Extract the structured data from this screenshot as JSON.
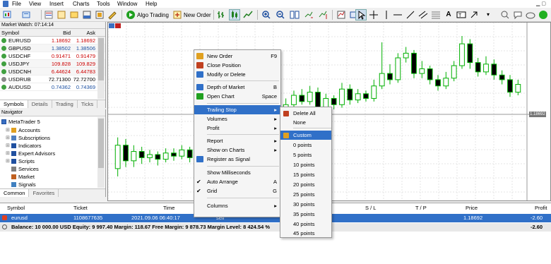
{
  "menu": [
    "File",
    "View",
    "Insert",
    "Charts",
    "Tools",
    "Window",
    "Help"
  ],
  "toolbar": {
    "algo_trading": "Algo Trading",
    "new_order": "New Order"
  },
  "market_watch": {
    "title": "Market Watch: 07:14:14",
    "headers": {
      "symbol": "Symbol",
      "bid": "Bid",
      "ask": "Ask"
    },
    "rows": [
      {
        "symbol": "EURUSD",
        "bid": "1.18692",
        "ask": "1.18692",
        "color": "#cc0000"
      },
      {
        "symbol": "GBPUSD",
        "bid": "1.38502",
        "ask": "1.38506",
        "color": "#1a4fa0"
      },
      {
        "symbol": "USDCHF",
        "bid": "0.91471",
        "ask": "0.91479",
        "color": "#cc0000"
      },
      {
        "symbol": "USDJPY",
        "bid": "109.828",
        "ask": "109.829",
        "color": "#cc0000"
      },
      {
        "symbol": "USDCNH",
        "bid": "6.44624",
        "ask": "6.44783",
        "color": "#cc0000"
      },
      {
        "symbol": "USDRUB",
        "bid": "72.71300",
        "ask": "72.72700",
        "color": "#000000"
      },
      {
        "symbol": "AUDUSD",
        "bid": "0.74362",
        "ask": "0.74369",
        "color": "#1a4fa0"
      }
    ],
    "tabs": [
      "Symbols",
      "Details",
      "Trading",
      "Ticks"
    ]
  },
  "navigator": {
    "title": "Navigator",
    "root": "MetaTrader 5",
    "items": [
      "Accounts",
      "Subscriptions",
      "Indicators",
      "Expert Advisors",
      "Scripts",
      "Services",
      "Market",
      "Signals"
    ],
    "tabs": [
      "Common",
      "Favorites"
    ]
  },
  "chart": {
    "price_label": "1.18692"
  },
  "chart_data": {
    "type": "candlestick",
    "bull_color": "#00b000",
    "bear_color": "#000000",
    "candles": [
      {
        "o": 1.5,
        "c": 3.0,
        "h": 3.5,
        "l": 1.0
      },
      {
        "o": 3.0,
        "c": 2.0,
        "h": 3.4,
        "l": 1.6
      },
      {
        "o": 2.0,
        "c": 2.6,
        "h": 3.0,
        "l": 1.6
      },
      {
        "o": 2.6,
        "c": 2.2,
        "h": 2.9,
        "l": 1.8
      },
      {
        "o": 2.2,
        "c": 2.4,
        "h": 2.7,
        "l": 1.9
      },
      {
        "o": 2.4,
        "c": 2.1,
        "h": 2.6,
        "l": 1.7
      },
      {
        "o": 2.1,
        "c": 2.5,
        "h": 2.8,
        "l": 1.9
      },
      {
        "o": 2.5,
        "c": 2.3,
        "h": 2.8,
        "l": 2.0
      },
      {
        "o": 2.3,
        "c": 2.7,
        "h": 3.0,
        "l": 2.1
      },
      {
        "o": 2.7,
        "c": 2.2,
        "h": 2.9,
        "l": 1.9
      },
      {
        "o": 2.2,
        "c": 2.6,
        "h": 2.9,
        "l": 2.0
      },
      {
        "o": 2.6,
        "c": 2.3,
        "h": 2.8,
        "l": 2.1
      },
      {
        "o": 2.3,
        "c": 2.9,
        "h": 3.2,
        "l": 2.1
      },
      {
        "o": 2.9,
        "c": 2.5,
        "h": 3.1,
        "l": 2.2
      },
      {
        "o": 2.5,
        "c": 3.0,
        "h": 3.3,
        "l": 2.3
      },
      {
        "o": 3.0,
        "c": 4.8,
        "h": 5.0,
        "l": 2.8
      },
      {
        "o": 4.8,
        "c": 4.2,
        "h": 5.3,
        "l": 4.0
      },
      {
        "o": 4.2,
        "c": 4.6,
        "h": 5.0,
        "l": 4.0
      },
      {
        "o": 4.6,
        "c": 4.1,
        "h": 4.9,
        "l": 3.8
      },
      {
        "o": 4.1,
        "c": 4.5,
        "h": 4.9,
        "l": 3.9
      },
      {
        "o": 4.5,
        "c": 5.2,
        "h": 5.5,
        "l": 4.3
      },
      {
        "o": 5.2,
        "c": 5.6,
        "h": 6.0,
        "l": 5.0
      },
      {
        "o": 5.6,
        "c": 6.2,
        "h": 6.5,
        "l": 5.4
      },
      {
        "o": 6.2,
        "c": 5.8,
        "h": 6.6,
        "l": 5.6
      },
      {
        "o": 5.8,
        "c": 6.4,
        "h": 6.8,
        "l": 5.6
      },
      {
        "o": 6.4,
        "c": 5.4,
        "h": 6.7,
        "l": 5.1
      },
      {
        "o": 5.4,
        "c": 6.0,
        "h": 6.3,
        "l": 5.2
      },
      {
        "o": 6.0,
        "c": 5.6,
        "h": 6.2,
        "l": 5.3
      },
      {
        "o": 5.6,
        "c": 6.6,
        "h": 7.0,
        "l": 5.4
      },
      {
        "o": 6.6,
        "c": 5.9,
        "h": 6.9,
        "l": 5.6
      },
      {
        "o": 5.9,
        "c": 6.3,
        "h": 6.6,
        "l": 5.7
      },
      {
        "o": 6.3,
        "c": 6.0,
        "h": 6.5,
        "l": 5.8
      },
      {
        "o": 6.0,
        "c": 6.8,
        "h": 7.2,
        "l": 5.8
      },
      {
        "o": 6.8,
        "c": 7.6,
        "h": 9.6,
        "l": 6.6
      },
      {
        "o": 7.6,
        "c": 7.2,
        "h": 8.2,
        "l": 6.9
      },
      {
        "o": 7.2,
        "c": 8.6,
        "h": 8.9,
        "l": 7.0
      },
      {
        "o": 8.6,
        "c": 8.9,
        "h": 9.3,
        "l": 8.3
      },
      {
        "o": 8.9,
        "c": 7.6,
        "h": 9.1,
        "l": 7.3
      },
      {
        "o": 7.6,
        "c": 7.9,
        "h": 8.4,
        "l": 7.3
      },
      {
        "o": 7.9,
        "c": 7.2,
        "h": 8.1,
        "l": 6.9
      },
      {
        "o": 7.2,
        "c": 6.8,
        "h": 7.5,
        "l": 6.5
      },
      {
        "o": 6.8,
        "c": 7.3,
        "h": 7.7,
        "l": 6.6
      },
      {
        "o": 7.3,
        "c": 8.1,
        "h": 8.4,
        "l": 7.1
      },
      {
        "o": 8.1,
        "c": 9.5,
        "h": 10.0,
        "l": 7.9
      },
      {
        "o": 9.5,
        "c": 8.3,
        "h": 9.8,
        "l": 7.9
      },
      {
        "o": 8.3,
        "c": 7.7,
        "h": 8.6,
        "l": 7.4
      },
      {
        "o": 7.7,
        "c": 8.2,
        "h": 8.7,
        "l": 7.5
      },
      {
        "o": 8.2,
        "c": 7.5,
        "h": 8.5,
        "l": 7.2
      },
      {
        "o": 7.5,
        "c": 7.2,
        "h": 7.8,
        "l": 6.9
      },
      {
        "o": 7.2,
        "c": 6.4,
        "h": 7.5,
        "l": 6.1
      },
      {
        "o": 6.4,
        "c": 6.9,
        "h": 7.2,
        "l": 6.2
      }
    ]
  },
  "context_menu": {
    "items": [
      {
        "label": "New Order",
        "shortcut": "F9"
      },
      {
        "label": "Close Position",
        "shortcut": ""
      },
      {
        "label": "Modify or Delete",
        "shortcut": ""
      },
      {
        "label": "Depth of Market",
        "shortcut": "B"
      },
      {
        "label": "Open Chart",
        "shortcut": "Space"
      },
      {
        "label": "Trailing Stop",
        "shortcut": ""
      },
      {
        "label": "Volumes",
        "shortcut": ""
      },
      {
        "label": "Profit",
        "shortcut": ""
      },
      {
        "label": "Report",
        "shortcut": ""
      },
      {
        "label": "Show on Charts",
        "shortcut": ""
      },
      {
        "label": "Register as Signal",
        "shortcut": ""
      },
      {
        "label": "Show Milliseconds",
        "shortcut": ""
      },
      {
        "label": "Auto Arrange",
        "shortcut": "A"
      },
      {
        "label": "Grid",
        "shortcut": "G"
      },
      {
        "label": "Columns",
        "shortcut": ""
      }
    ]
  },
  "submenu": {
    "items": [
      "Delete All",
      "None",
      "Custom",
      "0 points",
      "5 points",
      "10 points",
      "15 points",
      "20 points",
      "25 points",
      "30 points",
      "35 points",
      "40 points",
      "45 points"
    ]
  },
  "toolbox": {
    "headers": {
      "symbol": "Symbol",
      "ticket": "Ticket",
      "time": "Time",
      "sl": "S / L",
      "tp": "T / P",
      "price": "Price",
      "profit": "Profit"
    },
    "trade": {
      "symbol": "eurusd",
      "ticket": "1108677635",
      "time": "2021.09.06 06:40:17",
      "type": "sell",
      "price": "1.18692",
      "profit": "-2.60"
    },
    "balance": {
      "text": "Balance: 10 000.00 USD  Equity: 9 997.40  Margin: 118.67  Free Margin: 9 878.73  Margin Level: 8 424.54 %",
      "profit": "-2.60"
    }
  }
}
